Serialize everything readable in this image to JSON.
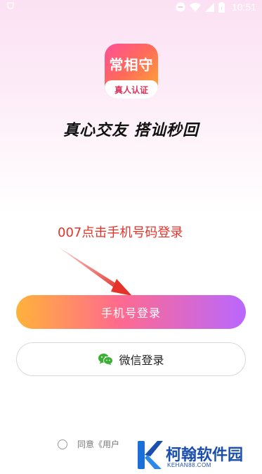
{
  "status_bar": {
    "time": "10:51",
    "icons": [
      "shield-icon",
      "minus-circle-icon",
      "wifi-icon",
      "signal-icon",
      "battery-icon"
    ],
    "color": "#ffffff"
  },
  "logo": {
    "name": "常相守",
    "badge": "真人认证",
    "colors": [
      "#ff4f9a",
      "#ff6a5a",
      "#ffb02e"
    ]
  },
  "slogan": "真心交友 搭讪秒回",
  "annotation": {
    "text": "007点击手机号码登录",
    "color": "#e5332a"
  },
  "buttons": {
    "phone_login": "手机号登录",
    "wechat_login": "微信登录"
  },
  "agreement": {
    "text": "同意《用户"
  },
  "watermark": {
    "name": "柯翰软件园",
    "url": "KEHAN88.COM",
    "color": "#1a4fb0"
  },
  "accent": {
    "gradient": [
      "#ffb23a",
      "#ff6a8f",
      "#b967ff"
    ],
    "wechat_green": "#3cb034"
  }
}
